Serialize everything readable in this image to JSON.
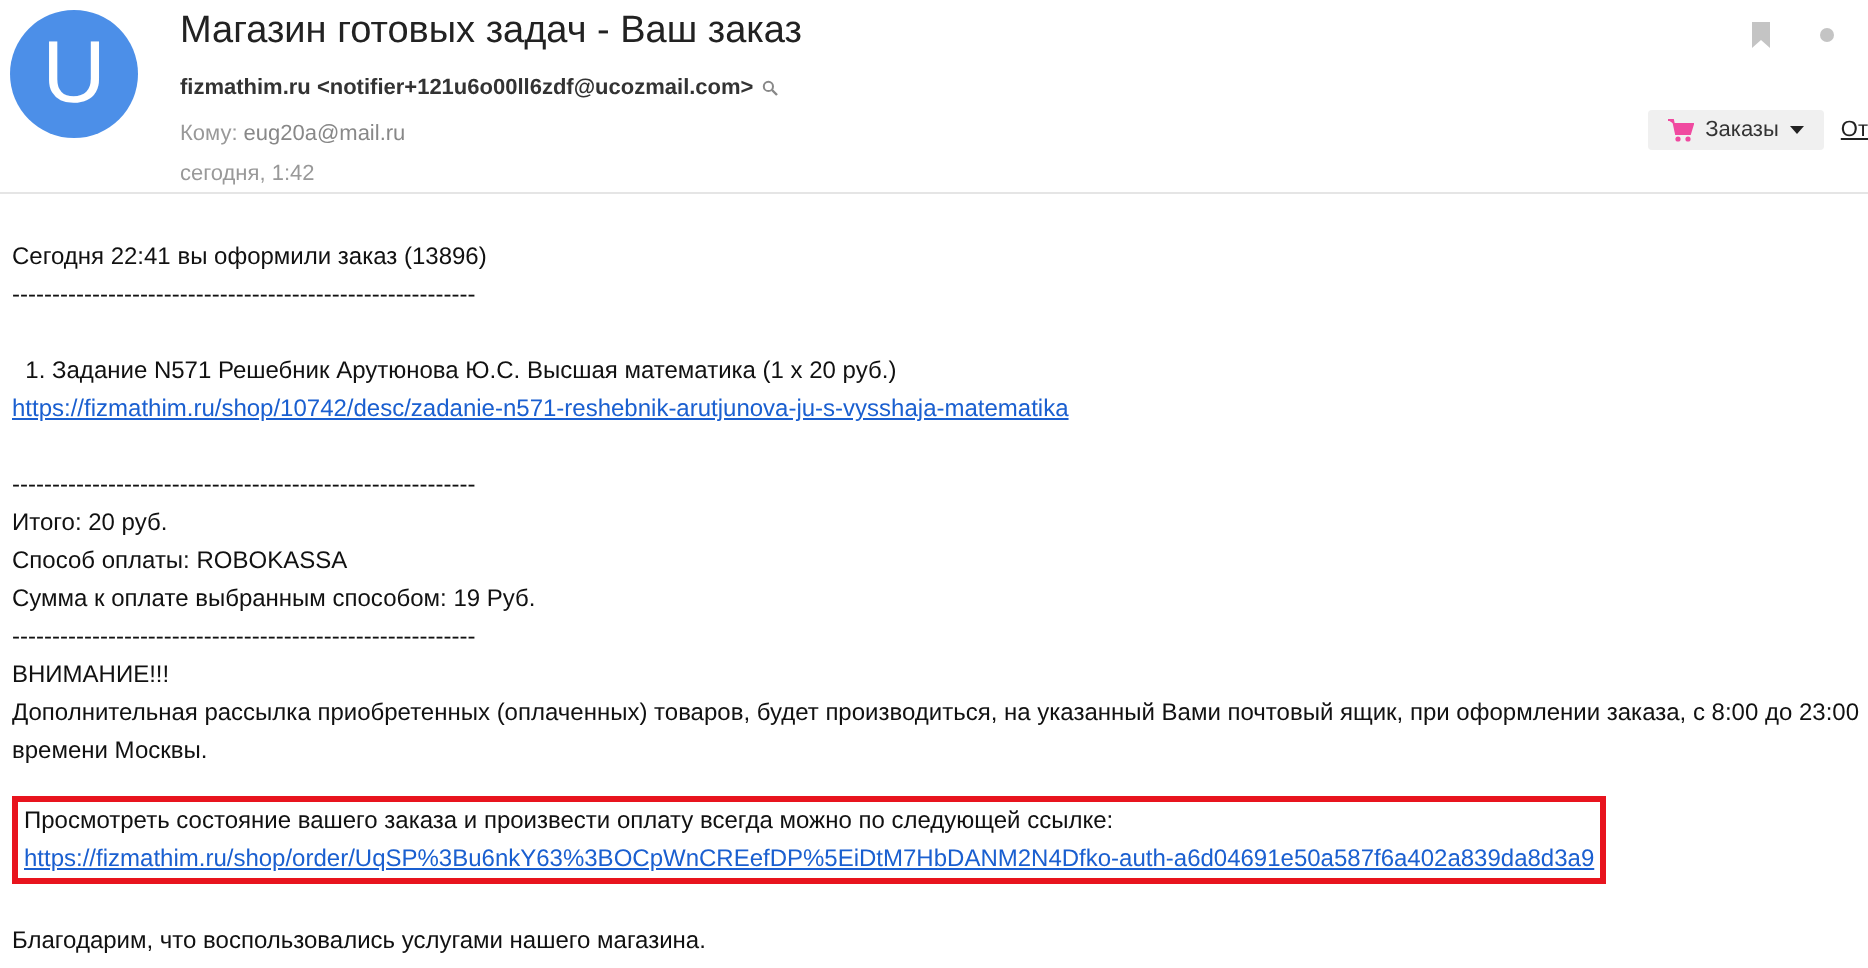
{
  "avatar": {
    "letter": "U"
  },
  "header": {
    "subject": "Магазин готовых задач - Ваш заказ",
    "sender": "fizmathim.ru <notifier+121u6o00ll6zdf@ucozmail.com>",
    "to_label": "Кому:",
    "to": "eug20a@mail.ru",
    "date": "сегодня, 1:42"
  },
  "toolbar": {
    "orders_button": "Заказы",
    "cut_link": "От"
  },
  "body": [
    {
      "kind": "text",
      "text": "Сегодня 22:41 вы оформили заказ (13896)"
    },
    {
      "kind": "text",
      "text": "----------------------------------------------------------"
    },
    {
      "kind": "gap"
    },
    {
      "kind": "text",
      "text": "  1. Задание N571 Решебник Арутюнова Ю.С. Высшая математика (1 x 20 руб.)"
    },
    {
      "kind": "link",
      "text": "https://fizmathim.ru/shop/10742/desc/zadanie-n571-reshebnik-arutjunova-ju-s-vysshaja-matematika"
    },
    {
      "kind": "gap"
    },
    {
      "kind": "text",
      "text": "----------------------------------------------------------"
    },
    {
      "kind": "text",
      "text": "Итого: 20 руб."
    },
    {
      "kind": "text",
      "text": "Способ оплаты: ROBOKASSA"
    },
    {
      "kind": "text",
      "text": "Сумма к оплате выбранным способом: 19 Руб."
    },
    {
      "kind": "text",
      "text": "----------------------------------------------------------"
    },
    {
      "kind": "text",
      "text": "ВНИМАНИЕ!!!"
    },
    {
      "kind": "text",
      "text": "Дополнительная рассылка приобретенных (оплаченных) товаров, будет производиться, на указанный Вами почтовый ящик, при оформлении заказа, с 8:00 до 23:00 времени Москвы."
    },
    {
      "kind": "gap"
    },
    {
      "kind": "highlight",
      "text": "Просмотреть состояние вашего заказа и произвести оплату всегда можно по следующей ссылке:",
      "link": "https://fizmathim.ru/shop/order/UqSP%3Bu6nkY63%3BOCpWnCREefDP%5EiDtM7HbDANM2N4Dfko-auth-a6d04691e50a587f6a402a839da8d3a9"
    },
    {
      "kind": "gap"
    },
    {
      "kind": "text",
      "text": "Благодарим, что воспользовались услугами нашего магазина."
    }
  ]
}
